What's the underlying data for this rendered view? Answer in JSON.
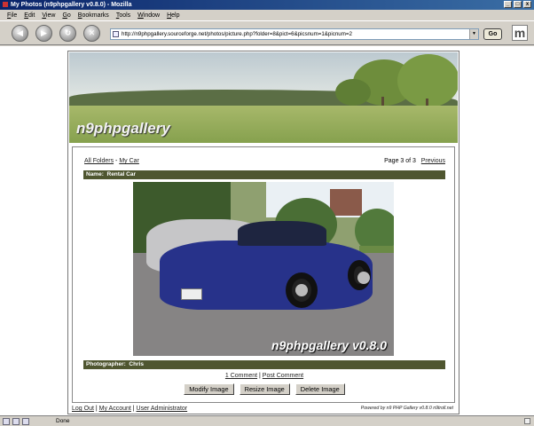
{
  "window": {
    "title": "My Photos (n9phpgallery v0.8.0) - Mozilla",
    "controls": [
      "_",
      "□",
      "x"
    ]
  },
  "menu": [
    "File",
    "Edit",
    "View",
    "Go",
    "Bookmarks",
    "Tools",
    "Window",
    "Help"
  ],
  "navigation": {
    "url": "http://n9phpgallery.sourceforge.net/photos/picture.php?folder=8&pict=6&picsnum=1&picnum=2",
    "go_label": "Go"
  },
  "banner": {
    "logo_text": "n9phpgallery"
  },
  "gallery": {
    "breadcrumb_all": "All Folders",
    "breadcrumb_sep": " - ",
    "breadcrumb_folder": "My Car",
    "page_info": "Page 3 of 3",
    "previous_label": "Previous",
    "name_label": "Name:",
    "name_value": "Rental Car",
    "watermark": "n9phpgallery v0.8.0",
    "photographer_label": "Photographer:",
    "photographer_value": "Chris",
    "comment_link": "1 Comment",
    "comment_sep": " | ",
    "post_comment_link": "Post Comment",
    "buttons": {
      "modify": "Modify Image",
      "resize": "Resize Image",
      "delete": "Delete Image"
    }
  },
  "footer": {
    "logout": "Log Out",
    "account": "My Account",
    "user": "User Administrator",
    "sep": " | ",
    "powered": "Powered by n9 PHP Gallery v0.8.0 n9troll.net"
  },
  "statusbar": {
    "text": "Done"
  }
}
